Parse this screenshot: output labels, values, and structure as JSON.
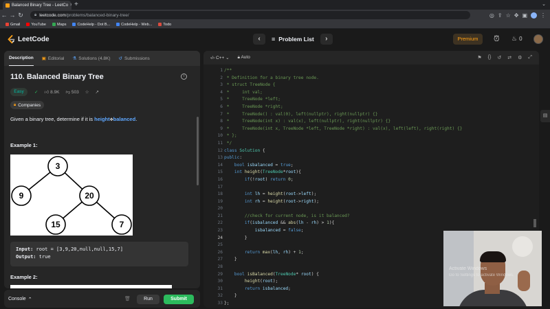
{
  "browser": {
    "tab_title": "Balanced Binary Tree - LeetCo",
    "url_host": "leetcode.com",
    "url_path": "/problems/balanced-binary-tree/",
    "bookmarks": [
      {
        "label": "Gmail",
        "color": "#ea4335"
      },
      {
        "label": "YouTube",
        "color": "#ff0000"
      },
      {
        "label": "Maps",
        "color": "#34a853"
      },
      {
        "label": "CodeHelp - Dot B...",
        "color": "#4285f4"
      },
      {
        "label": "CodeHelp - Web...",
        "color": "#4285f4"
      },
      {
        "label": "Todo",
        "color": "#db4c3f"
      }
    ]
  },
  "header": {
    "logo_text": "LeetCode",
    "problem_list": "Problem List",
    "premium": "Premium",
    "streak": "0"
  },
  "left": {
    "tabs": [
      "Description",
      "Editorial",
      "Solutions (4.8K)",
      "Submissions"
    ],
    "title": "110. Balanced Binary Tree",
    "difficulty": "Easy",
    "likes": "8.9K",
    "dislikes": "503",
    "companies": "Companies",
    "desc_pre": "Given a binary tree, determine if it is ",
    "desc_hl1": "height",
    "desc_hl2": "balanced",
    "desc_post": ".",
    "example1": "Example 1:",
    "example2": "Example 2:",
    "input_label": "Input:",
    "input_value": "root = [3,9,20,null,null,15,7]",
    "output_label": "Output:",
    "output_value": "true",
    "tree_nodes": [
      "3",
      "9",
      "20",
      "15",
      "7"
    ]
  },
  "console": {
    "label": "Console",
    "run": "Run",
    "submit": "Submit"
  },
  "editor": {
    "language": "C++",
    "mode": "Auto",
    "line_count": 33
  },
  "webcam": {
    "watermark1": "Activate Windows",
    "watermark2": "Go to Settings to activate Windows."
  }
}
